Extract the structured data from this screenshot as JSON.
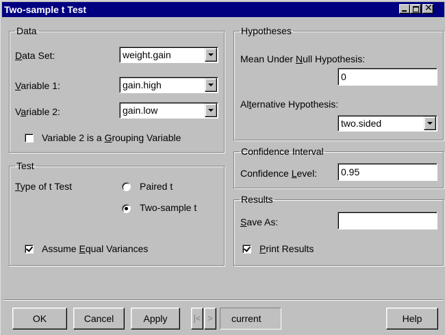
{
  "window": {
    "title": "Two-sample t Test"
  },
  "data_group": {
    "legend": "Data",
    "data_set_label": "Data Set:",
    "data_set_value": "weight.gain",
    "variable1_label": "Variable 1:",
    "variable1_value": "gain.high",
    "variable2_label": "Variable 2:",
    "variable2_value": "gain.low",
    "grouping_label": "Variable 2 is a Grouping Variable",
    "grouping_checked": false
  },
  "test_group": {
    "legend": "Test",
    "type_label": "Type of t Test",
    "paired_label": "Paired t",
    "twosample_label": "Two-sample t",
    "selected": "Two-sample t",
    "equal_var_label": "Assume Equal Variances",
    "equal_var_checked": true
  },
  "hypotheses_group": {
    "legend": "Hypotheses",
    "mean_label": "Mean Under Null Hypothesis:",
    "mean_value": "0",
    "alt_label": "Alternative Hypothesis:",
    "alt_value": "two.sided"
  },
  "confidence_group": {
    "legend": "Confidence Interval",
    "level_label": "Confidence Level:",
    "level_value": "0.95"
  },
  "results_group": {
    "legend": "Results",
    "save_as_label": "Save As:",
    "save_as_value": "",
    "print_label": "Print Results",
    "print_checked": true
  },
  "buttons": {
    "ok": "OK",
    "cancel": "Cancel",
    "apply": "Apply",
    "prev": "|<",
    "next": ">",
    "current": "current",
    "help": "Help"
  }
}
